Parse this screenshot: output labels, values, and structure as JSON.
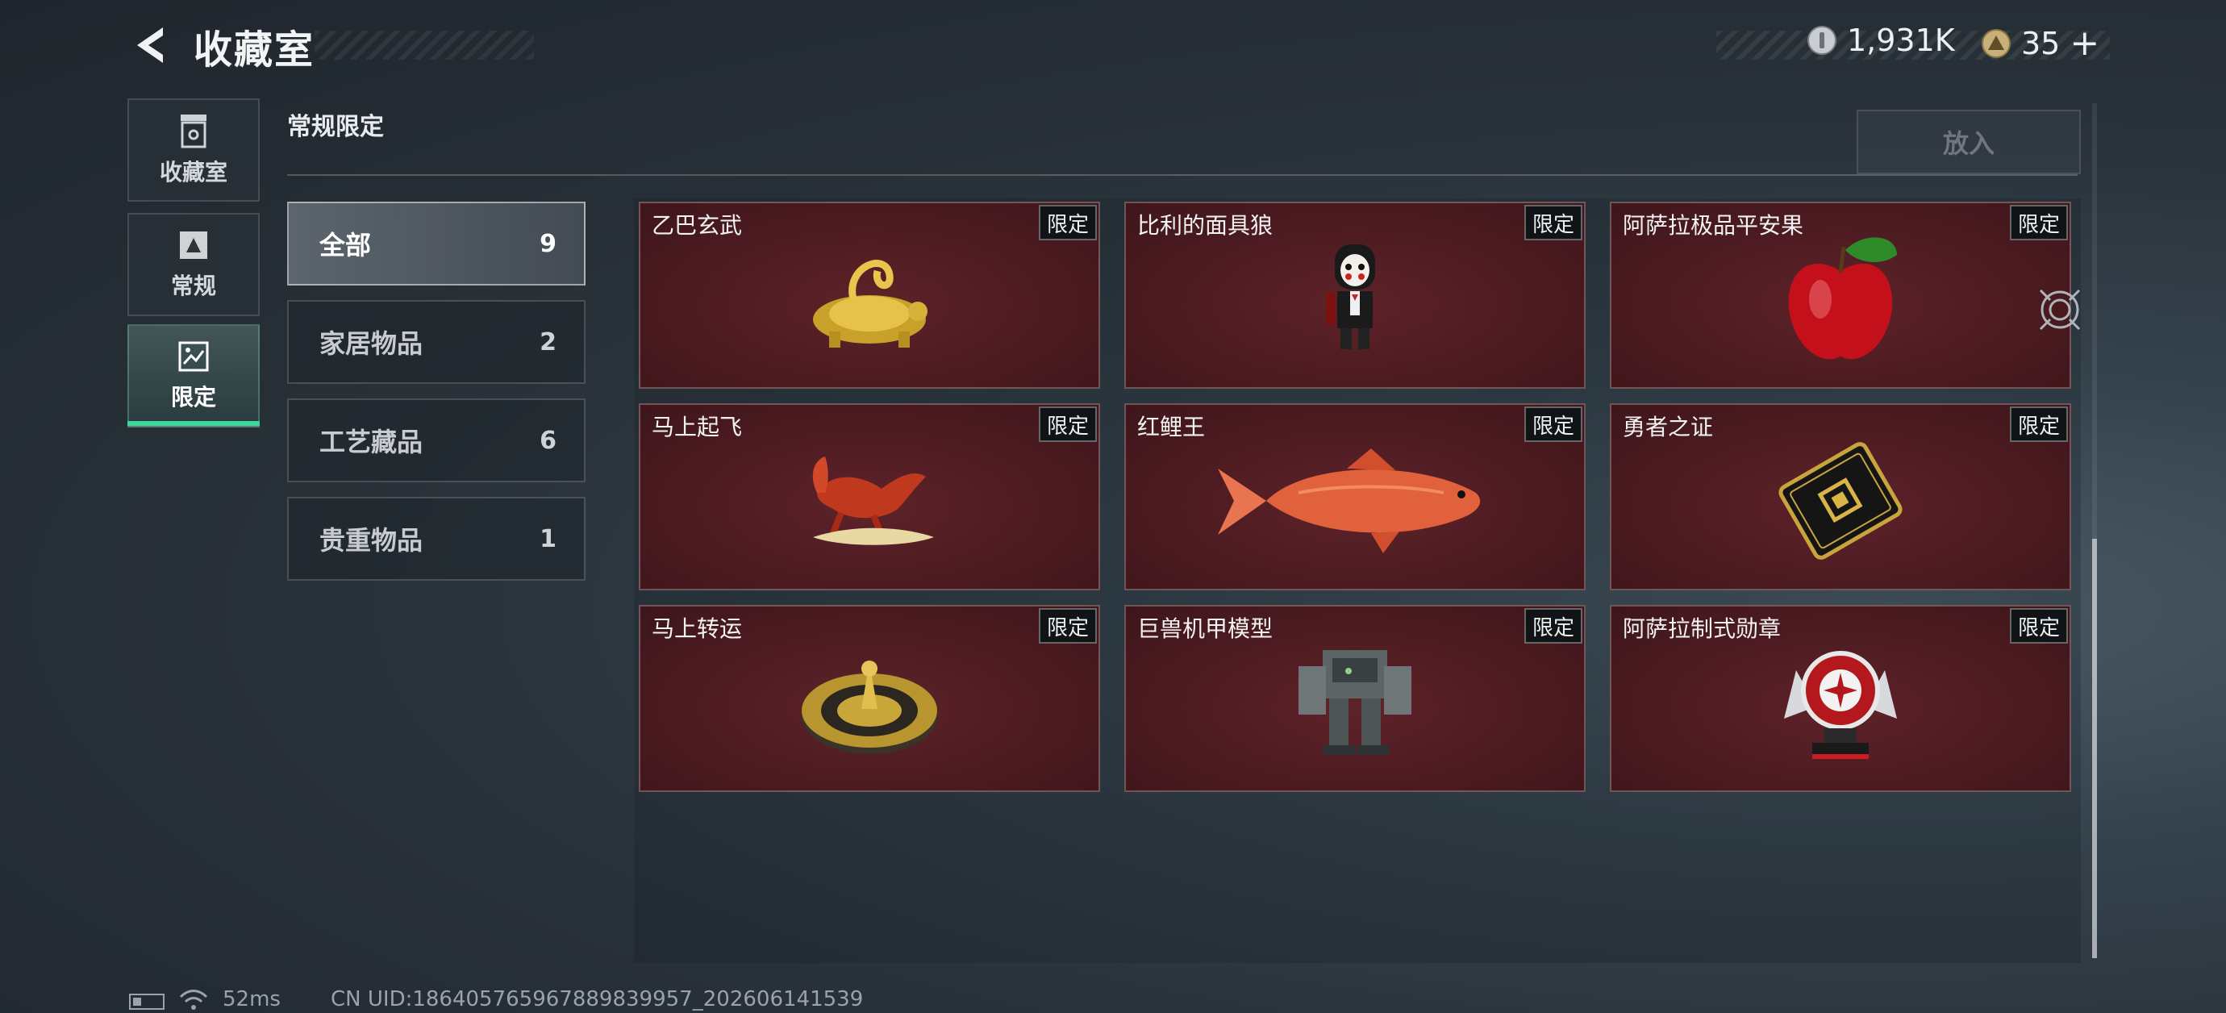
{
  "header": {
    "title": "收藏室",
    "currencies": [
      {
        "icon": "silver-coin-icon",
        "value": "1,931K"
      },
      {
        "icon": "gold-triangle-icon",
        "value": "35"
      }
    ],
    "add_symbol": "+"
  },
  "nav": {
    "items": [
      {
        "label": "收藏室",
        "icon": "collection-room-icon"
      },
      {
        "label": "常规",
        "icon": "regular-book-icon"
      },
      {
        "label": "限定",
        "icon": "limited-picture-icon"
      }
    ],
    "active": "限定"
  },
  "section": {
    "title": "常规限定",
    "put_in_label": "放入"
  },
  "categories": [
    {
      "name": "全部",
      "count": "9"
    },
    {
      "name": "家居物品",
      "count": "2"
    },
    {
      "name": "工艺藏品",
      "count": "6"
    },
    {
      "name": "贵重物品",
      "count": "1"
    }
  ],
  "items": [
    {
      "name": "乙巴玄武",
      "tag": "限定",
      "icon": "golden-tortoise-snake-icon"
    },
    {
      "name": "比利的面具狼",
      "tag": "限定",
      "icon": "puppet-figure-icon"
    },
    {
      "name": "阿萨拉极品平安果",
      "tag": "限定",
      "icon": "red-apple-icon"
    },
    {
      "name": "马上起飞",
      "tag": "限定",
      "icon": "red-horse-statue-icon"
    },
    {
      "name": "红鲤王",
      "tag": "限定",
      "icon": "red-carp-icon"
    },
    {
      "name": "勇者之证",
      "tag": "限定",
      "icon": "black-gold-card-icon"
    },
    {
      "name": "马上转运",
      "tag": "限定",
      "icon": "golden-disc-icon"
    },
    {
      "name": "巨兽机甲模型",
      "tag": "限定",
      "icon": "mech-model-icon"
    },
    {
      "name": "阿萨拉制式勋章",
      "tag": "限定",
      "icon": "medal-icon"
    }
  ],
  "status": {
    "ping": "52ms",
    "uid": "CN UID:18640576596788983995​7_202606141539"
  },
  "colors": {
    "accent": "#3fd59a",
    "card_bg": "#4c1b21"
  }
}
